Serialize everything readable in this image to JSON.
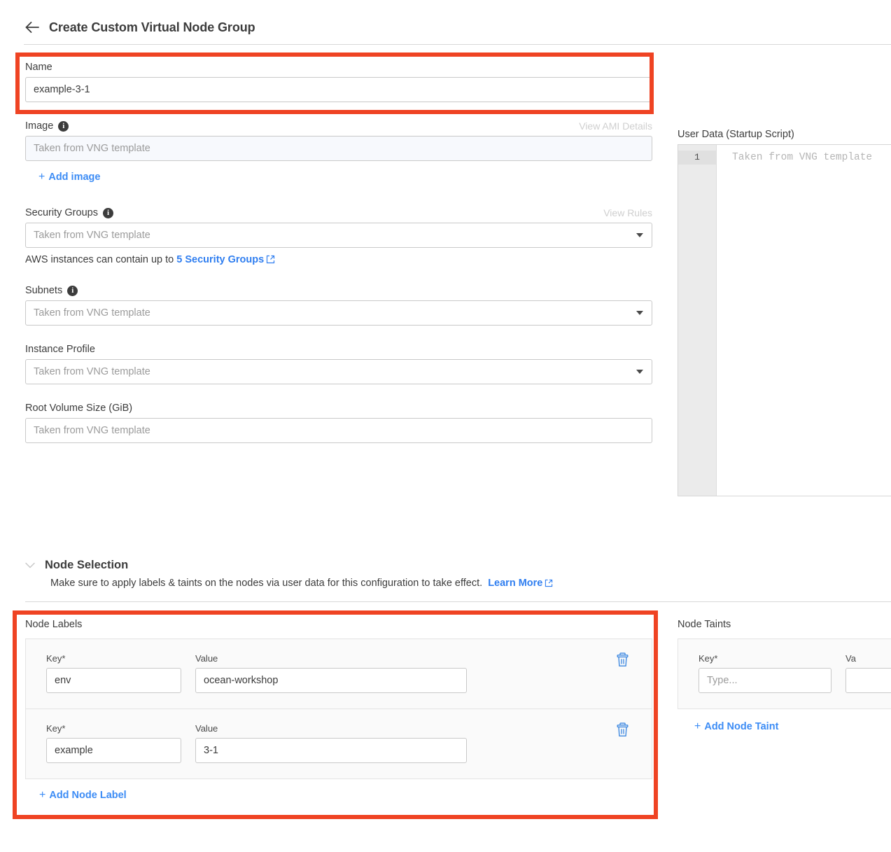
{
  "header": {
    "title": "Create Custom Virtual Node Group",
    "back_icon": "arrow-left-icon"
  },
  "name_field": {
    "label": "Name",
    "value": "example-3-1"
  },
  "image_field": {
    "label": "Image",
    "placeholder": "Taken from VNG template",
    "action_label": "View AMI Details",
    "add_label": "Add image",
    "plus": "+"
  },
  "security_groups_field": {
    "label": "Security Groups",
    "placeholder": "Taken from VNG template",
    "action_label": "View Rules",
    "hint_prefix": "AWS instances can contain up to",
    "hint_link": "5 Security Groups"
  },
  "subnets_field": {
    "label": "Subnets",
    "placeholder": "Taken from VNG template"
  },
  "instance_profile_field": {
    "label": "Instance Profile",
    "placeholder": "Taken from VNG template"
  },
  "root_volume_field": {
    "label": "Root Volume Size (GiB)",
    "placeholder": "Taken from VNG template"
  },
  "user_data": {
    "label": "User Data (Startup Script)",
    "line_number": "1",
    "placeholder": "Taken from VNG template"
  },
  "node_selection": {
    "title": "Node Selection",
    "chevron": "⌄",
    "description": "Make sure to apply labels & taints on the nodes via user data for this configuration to take effect.",
    "learn_more": "Learn More"
  },
  "node_labels": {
    "title": "Node Labels",
    "key_label": "Key*",
    "value_label": "Value",
    "rows": [
      {
        "key": "env",
        "value": "ocean-workshop"
      },
      {
        "key": "example",
        "value": "3-1"
      }
    ],
    "add_label": "Add Node Label",
    "plus": "+"
  },
  "node_taints": {
    "title": "Node Taints",
    "key_label": "Key*",
    "value_label": "Va",
    "key_placeholder": "Type...",
    "add_label": "Add Node Taint",
    "plus": "+"
  },
  "colors": {
    "highlight": "#ef4323",
    "link": "#3c8cf5",
    "trash": "#4a90e2",
    "text": "#3c3c3c",
    "disabled": "#cfcfcf"
  }
}
